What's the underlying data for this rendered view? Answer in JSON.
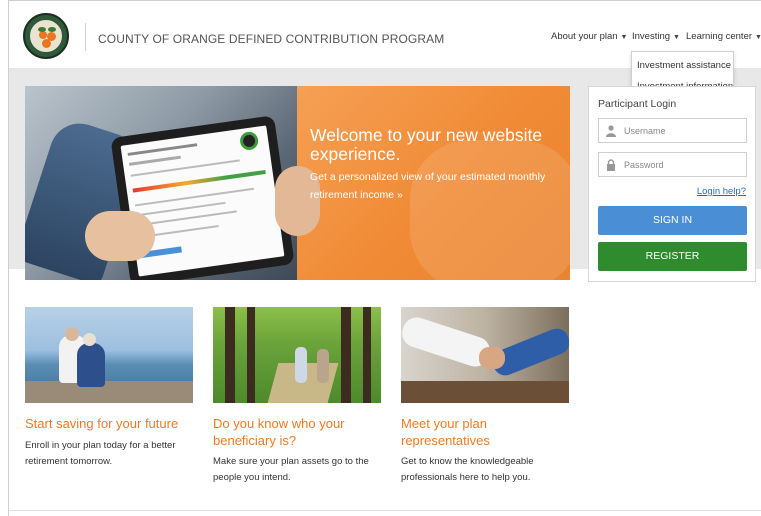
{
  "header": {
    "logo_text": "COUNTY OF ORANGE CALIFORNIA",
    "title": "COUNTY OF ORANGE DEFINED CONTRIBUTION PROGRAM",
    "nav": [
      {
        "label": "About your plan"
      },
      {
        "label": "Investing"
      },
      {
        "label": "Learning center"
      }
    ],
    "dropdown": [
      {
        "label": "Investment assistance"
      },
      {
        "label": "Investment information"
      }
    ]
  },
  "hero": {
    "heading": "Welcome to your new website experience.",
    "text": "Get a personalized view of your estimated monthly retirement income »"
  },
  "login": {
    "title": "Participant Login",
    "username_placeholder": "Username",
    "password_placeholder": "Password",
    "help_link": "Login help?",
    "signin_label": "SIGN IN",
    "register_label": "REGISTER"
  },
  "cards": [
    {
      "heading": "Start saving for your future",
      "text": "Enroll in your plan today for a better retirement tomorrow."
    },
    {
      "heading": "Do you know who your beneficiary is?",
      "text": "Make sure your plan assets go to the people you intend."
    },
    {
      "heading": "Meet your plan representatives",
      "text": "Get to know the knowledgeable professionals here to help you."
    }
  ],
  "colors": {
    "accent_orange": "#f07a22",
    "signin_blue": "#4a8fd6",
    "register_green": "#2e8b2e"
  }
}
